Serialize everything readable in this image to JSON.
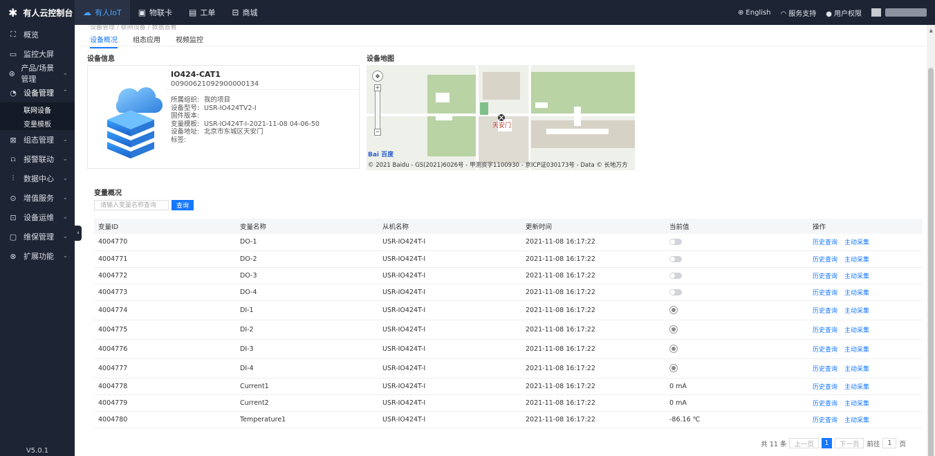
{
  "brand": {
    "title": "有人云控制台"
  },
  "topnav": [
    {
      "label": "有人IoT",
      "icon": "cloud-icon",
      "active": true
    },
    {
      "label": "物联卡",
      "icon": "sim-card-icon",
      "active": false
    },
    {
      "label": "工单",
      "icon": "ticket-icon",
      "active": false
    },
    {
      "label": "商城",
      "icon": "shop-icon",
      "active": false
    }
  ],
  "topright": {
    "language": "English",
    "support": "服务支持",
    "permission": "用户权限"
  },
  "sidebar": {
    "items": [
      {
        "label": "概览",
        "icon": "overview-icon"
      },
      {
        "label": "监控大屏",
        "icon": "monitor-icon"
      },
      {
        "label": "产品/场景管理",
        "icon": "product-icon"
      },
      {
        "label": "设备管理",
        "icon": "device-icon"
      },
      {
        "label": "组态管理",
        "icon": "config-icon"
      },
      {
        "label": "报警联动",
        "icon": "alarm-icon"
      },
      {
        "label": "数据中心",
        "icon": "data-icon"
      },
      {
        "label": "增值服务",
        "icon": "service-icon"
      },
      {
        "label": "设备运维",
        "icon": "maintenance-icon"
      },
      {
        "label": "维保管理",
        "icon": "warranty-icon"
      },
      {
        "label": "扩展功能",
        "icon": "extension-icon"
      }
    ],
    "subitems": [
      {
        "label": "联网设备"
      },
      {
        "label": "变量模板"
      }
    ],
    "version": "V5.0.1"
  },
  "breadcrumb": "设备管理 / 联网设备 / 数据查看",
  "tabs": [
    {
      "label": "设备概况"
    },
    {
      "label": "组态应用"
    },
    {
      "label": "视频监控"
    }
  ],
  "device_info": {
    "section_title": "设备信息",
    "name": "IO424-CAT1",
    "sn": "00900621092900000134",
    "fields": [
      {
        "key": "所属组织:",
        "value": "我的项目"
      },
      {
        "key": "设备型号:",
        "value": "USR-IO424TV2-I"
      },
      {
        "key": "固件版本:",
        "value": ""
      },
      {
        "key": "变量模板:",
        "value": "USR-IO424T-I-2021-11-08 04-06-50"
      },
      {
        "key": "设备地址:",
        "value": "北京市东城区天安门"
      },
      {
        "key": "标签:",
        "value": ""
      }
    ]
  },
  "map": {
    "section_title": "设备地图",
    "copyright": "© 2021 Baidu - GS(2021)6026号 - 甲测资字1100930 - 京ICP证030173号 - Data © 长地万方",
    "label": "天安门",
    "logo": "Bai 百度"
  },
  "variables": {
    "section_title": "变量概况",
    "search_placeholder": "请输入变量名称查询",
    "query_label": "查询",
    "columns": [
      "变量ID",
      "变量名称",
      "从机名称",
      "更新时间",
      "当前值",
      "操作"
    ],
    "rows": [
      {
        "id": "4004770",
        "name": "DO-1",
        "slave": "USR-IO424T-I",
        "time": "2021-11-08 16:17:22",
        "value_type": "toggle",
        "value": ""
      },
      {
        "id": "4004771",
        "name": "DO-2",
        "slave": "USR-IO424T-I",
        "time": "2021-11-08 16:17:22",
        "value_type": "toggle",
        "value": ""
      },
      {
        "id": "4004772",
        "name": "DO-3",
        "slave": "USR-IO424T-I",
        "time": "2021-11-08 16:17:22",
        "value_type": "toggle",
        "value": ""
      },
      {
        "id": "4004773",
        "name": "DO-4",
        "slave": "USR-IO424T-I",
        "time": "2021-11-08 16:17:22",
        "value_type": "toggle",
        "value": ""
      },
      {
        "id": "4004774",
        "name": "DI-1",
        "slave": "USR-IO424T-I",
        "time": "2021-11-08 16:17:22",
        "value_type": "led",
        "value": ""
      },
      {
        "id": "4004775",
        "name": "DI-2",
        "slave": "USR-IO424T-I",
        "time": "2021-11-08 16:17:22",
        "value_type": "led",
        "value": ""
      },
      {
        "id": "4004776",
        "name": "DI-3",
        "slave": "USR-IO424T-I",
        "time": "2021-11-08 16:17:22",
        "value_type": "led",
        "value": ""
      },
      {
        "id": "4004777",
        "name": "DI-4",
        "slave": "USR-IO424T-I",
        "time": "2021-11-08 16:17:22",
        "value_type": "led",
        "value": ""
      },
      {
        "id": "4004778",
        "name": "Current1",
        "slave": "USR-IO424T-I",
        "time": "2021-11-08 16:17:22",
        "value_type": "text",
        "value": "0 mA"
      },
      {
        "id": "4004779",
        "name": "Current2",
        "slave": "USR-IO424T-I",
        "time": "2021-11-08 16:17:22",
        "value_type": "text",
        "value": "0 mA"
      },
      {
        "id": "4004780",
        "name": "Temperature1",
        "slave": "USR-IO424T-I",
        "time": "2021-11-08 16:17:22",
        "value_type": "text",
        "value": "-86.16 ℃"
      }
    ],
    "actions": {
      "history": "历史查询",
      "collect": "主动采集"
    }
  },
  "pager": {
    "total": "共 11 条",
    "prev": "上一页",
    "current": "1",
    "next": "下一页",
    "goto": "前往",
    "goto_value": "1",
    "page_unit": "页"
  },
  "colors": {
    "sidebar_bg": "#1d2433",
    "accent": "#1677ff"
  }
}
